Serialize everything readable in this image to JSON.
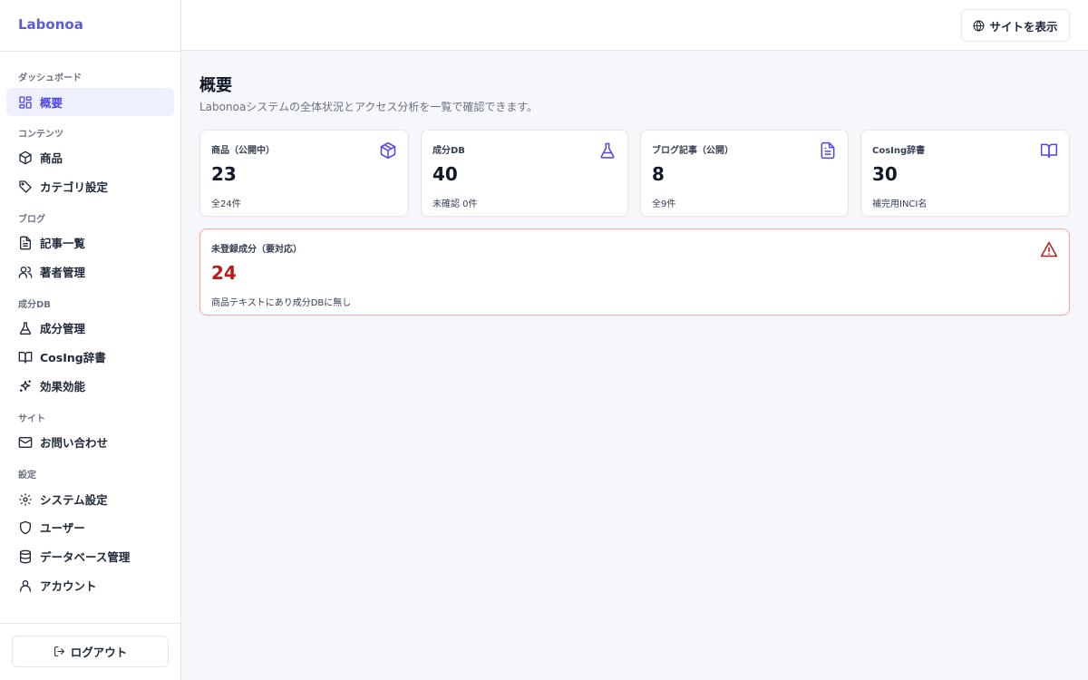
{
  "brand": "Labonoa",
  "sidebar": {
    "sections": [
      {
        "label": "ダッシュボード"
      },
      {
        "label": "コンテンツ"
      },
      {
        "label": "ブログ"
      },
      {
        "label": "成分DB"
      },
      {
        "label": "サイト"
      },
      {
        "label": "設定"
      }
    ],
    "items": [
      {
        "label": "概要",
        "icon": "grid-icon",
        "active": true
      },
      {
        "label": "商品",
        "icon": "box-icon"
      },
      {
        "label": "カテゴリ設定",
        "icon": "tag-icon"
      },
      {
        "label": "記事一覧",
        "icon": "document-icon"
      },
      {
        "label": "著者管理",
        "icon": "users-icon"
      },
      {
        "label": "成分管理",
        "icon": "flask-icon"
      },
      {
        "label": "CosIng辞書",
        "icon": "book-icon"
      },
      {
        "label": "効果効能",
        "icon": "sparkles-icon"
      },
      {
        "label": "お問い合わせ",
        "icon": "mail-icon"
      },
      {
        "label": "システム設定",
        "icon": "gear-icon"
      },
      {
        "label": "ユーザー",
        "icon": "shield-icon"
      },
      {
        "label": "データベース管理",
        "icon": "database-icon"
      },
      {
        "label": "アカウント",
        "icon": "user-icon"
      }
    ],
    "logout_label": "ログアウト"
  },
  "topbar": {
    "site_button_label": "サイトを表示"
  },
  "main": {
    "title": "概要",
    "subtitle": "Labonoaシステムの全体状況とアクセス分析を一覧で確認できます。",
    "cards": [
      {
        "label": "商品（公開中）",
        "value": "23",
        "sub": "全24件",
        "icon": "box-icon"
      },
      {
        "label": "成分DB",
        "value": "40",
        "sub": "未確認 0件",
        "icon": "flask-icon"
      },
      {
        "label": "ブログ記事（公開）",
        "value": "8",
        "sub": "全9件",
        "icon": "document-icon"
      },
      {
        "label": "CosIng辞書",
        "value": "30",
        "sub": "補完用INCI名",
        "icon": "book-icon"
      }
    ],
    "alert_card": {
      "label": "未登録成分（要対応）",
      "value": "24",
      "sub": "商品テキストにあり成分DBに無し",
      "icon": "warning-icon"
    }
  },
  "colors": {
    "accent": "#4f46e5",
    "active_bg": "#eef0fd",
    "danger": "#b91c1c",
    "danger_border": "#fca5a5"
  }
}
